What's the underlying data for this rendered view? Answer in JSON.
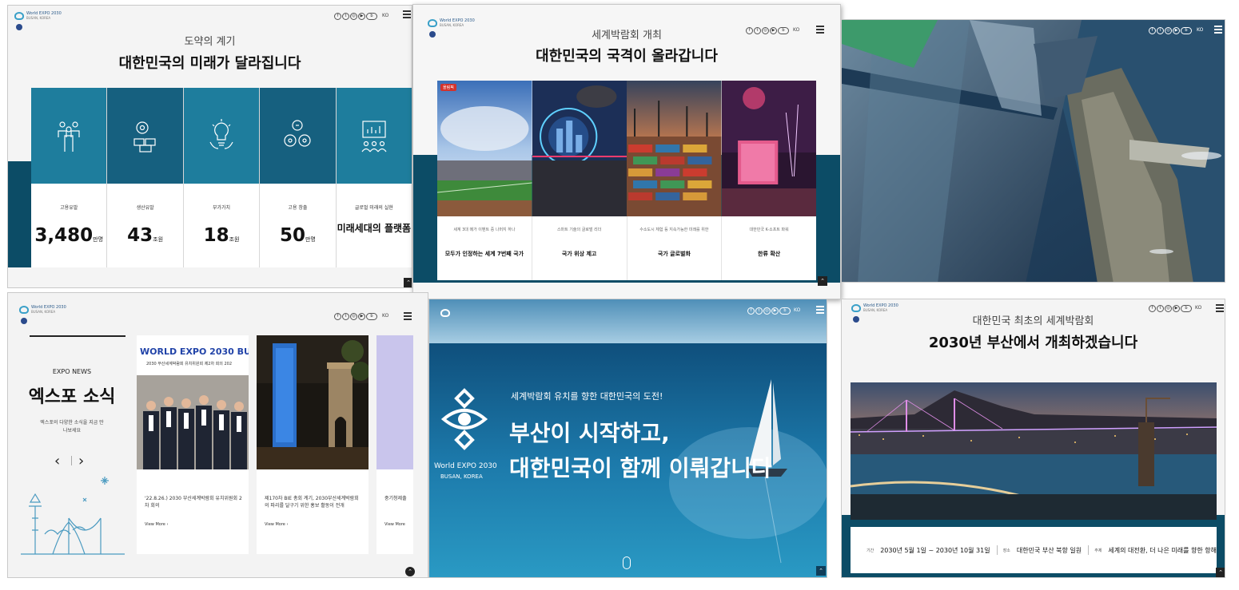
{
  "header": {
    "logo_line1": "World EXPO 2030",
    "logo_line2": "BUSAN, KOREA",
    "lang": "KO",
    "social_icons": [
      "facebook-icon",
      "twitter-icon",
      "instagram-icon",
      "youtube-icon",
      "blog-icon"
    ]
  },
  "panel1": {
    "subtitle": "도약의 계기",
    "title": "대한민국의 미래가 달라집니다",
    "stats": [
      {
        "label": "고용유발",
        "value": "3,480",
        "unit": "만명",
        "icon": "people-icon"
      },
      {
        "label": "생산유발",
        "value": "43",
        "unit": "조원",
        "icon": "gear-boxes-icon"
      },
      {
        "label": "부가가치",
        "value": "18",
        "unit": "조원",
        "icon": "lightbulb-icon"
      },
      {
        "label": "고용 창출",
        "value": "50",
        "unit": "만명",
        "icon": "gears-icon"
      },
      {
        "label": "글로벌 미래의 실현",
        "value": "미래세대의 플랫폼",
        "unit": "",
        "icon": "presentation-icon"
      }
    ]
  },
  "panel2": {
    "subtitle": "세계박람회 개최",
    "title": "대한민국의 국격이 올라갑니다",
    "new_tag": "올림픽",
    "captions": [
      {
        "small": "세계 3대 메가 이벤트 중 나머지 하나",
        "main": "모두가 인정하는 세계 7번째 국가"
      },
      {
        "small": "스마트 기술의 글로벌 리더",
        "main": "국가 위상 제고"
      },
      {
        "small": "수소도시 체험 등 지속가능한 미래를 위한",
        "main": "국가 글로벌화"
      },
      {
        "small": "대한민국 K-소프트 파워",
        "main": "한류 확산"
      }
    ]
  },
  "panel4": {
    "news_en": "EXPO NEWS",
    "news_ko": "엑스포 소식",
    "news_desc": "엑스포의 다양한 소식을 지금 만나보세요",
    "prev": "‹",
    "next": "›",
    "banner": "WORLD EXPO 2030 BUSAN",
    "banner_sub": "2030 부산세계박람회 유치위원회 제2차 회의 202",
    "cards": [
      {
        "text": "'22.8.26.) 2030 부산세계박람회 유치위원회 2차 회의",
        "more": "View More"
      },
      {
        "text": "제170차 BIE 총회 계기, 2030부산세계박람회의 파리를 달구기 위한 홍보 활동이 전개",
        "more": "View More"
      },
      {
        "text": "중기청제출",
        "more": "View More"
      }
    ]
  },
  "panel5": {
    "tagline": "세계박람회 유치를 향한 대한민국의 도전!",
    "headline1": "부산이 시작하고,",
    "headline2": "대한민국이 함께 이뤄갑니다",
    "brand1": "World EXPO 2030",
    "brand2": "BUSAN, KOREA"
  },
  "panel6": {
    "subtitle": "대한민국 최초의 세계박람회",
    "title": "2030년 부산에서 개최하겠습니다",
    "period_label": "기간",
    "period": "2030년 5월 1일 ~ 2030년 10월 31일",
    "place_label": "장소",
    "place": "대한민국 부산 북항 일원",
    "theme_label": "주제",
    "theme": "세계의 대전환, 더 나은 미래를 향한 항해"
  },
  "colors": {
    "teal": "#1e7d9d",
    "navy": "#0c4c66",
    "sea": "#1c6e9a"
  }
}
